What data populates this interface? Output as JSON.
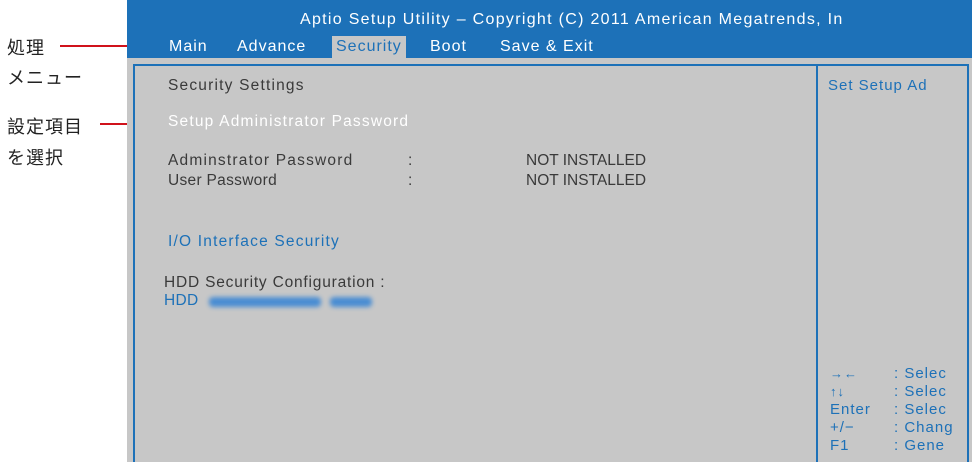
{
  "annotations": {
    "menu_label_line1": "処理",
    "menu_label_line2": "メニュー",
    "item_label_line1": "設定項目",
    "item_label_line2": "を選択"
  },
  "title": "Aptio Setup Utility – Copyright (C) 2011 American Megatrends, In",
  "menu": [
    "Main",
    "Advance",
    "Security",
    "Boot",
    "Save & Exit"
  ],
  "active_menu": "Security",
  "main": {
    "section_title": "Security Settings",
    "selected_item": "Setup Administrator Password",
    "admin_password_label": "Adminstrator Password",
    "admin_password_colon": ":",
    "admin_password_value": "NOT INSTALLED",
    "user_password_label": "User Password",
    "user_password_colon": ":",
    "user_password_value": "NOT INSTALLED",
    "io_interface_security": "I/O Interface Security",
    "hdd_security_config": "HDD Security Configuration :",
    "hdd_label": "HDD"
  },
  "help": {
    "description": "Set Setup Ad",
    "keys": [
      {
        "key": "→←",
        "desc": ": Selec"
      },
      {
        "key": "↑↓",
        "desc": ": Selec"
      },
      {
        "key": "Enter",
        "desc": ": Selec"
      },
      {
        "key": "+/−",
        "desc": ": Chang"
      },
      {
        "key": "F1",
        "desc": ": Gene"
      }
    ]
  },
  "colors": {
    "bios_blue": "#1d71b8",
    "bios_gray": "#c7c7c7",
    "annotation_red": "#d0121b"
  }
}
